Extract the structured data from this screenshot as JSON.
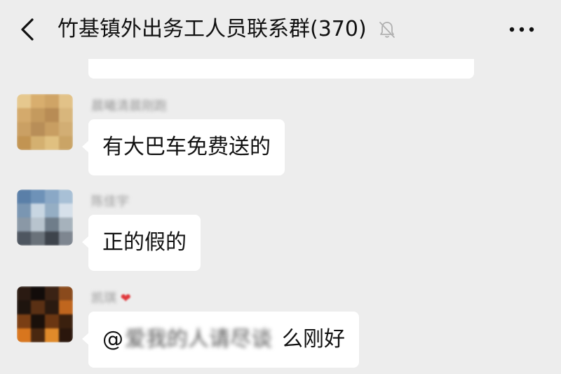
{
  "header": {
    "title": "竹基镇外出务工人员联系群(370)",
    "back_icon": "chevron-left-icon",
    "mute_icon": "bell-slash-icon",
    "more_icon": "more-horizontal-icon"
  },
  "messages": [
    {
      "sender": "晨曦清晨刚跑",
      "text": "有大巴车免费送的"
    },
    {
      "sender": "陈佳宇",
      "text": "正的假的"
    },
    {
      "sender": "凯琪",
      "sender_emoji": "❤",
      "mention_prefix": "@",
      "mention_name": "爱我的人请尽谈",
      "text": "么刚好"
    }
  ],
  "colors": {
    "background": "#ededed",
    "bubble": "#ffffff",
    "text": "#111111",
    "sender": "#9a9a9a"
  }
}
